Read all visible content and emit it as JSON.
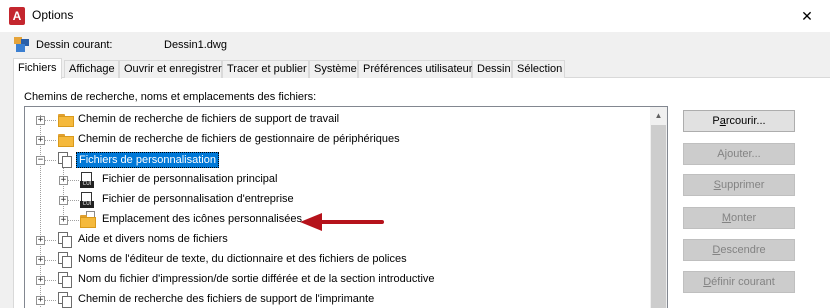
{
  "window": {
    "title": "Options",
    "close_glyph": "✕"
  },
  "current_drawing": {
    "label": "Dessin courant:",
    "value": "Dessin1.dwg"
  },
  "tabs": [
    {
      "label": "Fichiers",
      "active": true
    },
    {
      "label": "Affichage"
    },
    {
      "label": "Ouvrir et enregistrer"
    },
    {
      "label": "Tracer et publier"
    },
    {
      "label": "Système"
    },
    {
      "label": "Préférences utilisateur"
    },
    {
      "label": "Dessin"
    },
    {
      "label": "Sélection"
    }
  ],
  "section": {
    "label": "Chemins de recherche, noms et emplacements des fichiers:"
  },
  "tree": {
    "items": [
      {
        "label": "Chemin de recherche de fichiers de support de travail",
        "icon": "folder-icon",
        "expander": "+"
      },
      {
        "label": "Chemin de recherche de fichiers de gestionnaire de périphériques",
        "icon": "folder-icon",
        "expander": "+"
      },
      {
        "label": "Fichiers de personnalisation",
        "icon": "document-icon",
        "expander": "−",
        "selected": true
      },
      {
        "label": "Fichier de personnalisation principal",
        "icon": "cui-file-icon",
        "expander": "+"
      },
      {
        "label": "Fichier de personnalisation d'entreprise",
        "icon": "cui-file-icon",
        "expander": "+"
      },
      {
        "label": "Emplacement des icônes personnalisées",
        "icon": "folder-icon",
        "expander": "+"
      },
      {
        "label": "Aide et divers noms de fichiers",
        "icon": "pages-icon",
        "expander": "+"
      },
      {
        "label": "Noms de l'éditeur de texte, du dictionnaire et des fichiers de polices",
        "icon": "pages-icon",
        "expander": "+"
      },
      {
        "label": "Nom du fichier d'impression/de sortie différée et de la section introductive",
        "icon": "pages-icon",
        "expander": "+"
      },
      {
        "label": "Chemin de recherche des fichiers de support de l'imprimante",
        "icon": "pages-icon",
        "expander": "+"
      }
    ]
  },
  "buttons": {
    "browse": {
      "prefix": "P",
      "mnemonic": "a",
      "suffix": "rcourir..."
    },
    "add": {
      "prefix": "A",
      "mnemonic": "j",
      "suffix": "outer..."
    },
    "remove": {
      "prefix": "",
      "mnemonic": "S",
      "suffix": "upprimer"
    },
    "move_up": {
      "prefix": "",
      "mnemonic": "M",
      "suffix": "onter"
    },
    "move_down": {
      "prefix": "",
      "mnemonic": "D",
      "suffix": "escendre"
    },
    "set_current": {
      "prefix": "",
      "mnemonic": "D",
      "suffix": "éfinir courant"
    }
  },
  "colors": {
    "selection": "#0078d7",
    "arrow": "#b5121b",
    "app_icon": "#c4262e"
  }
}
